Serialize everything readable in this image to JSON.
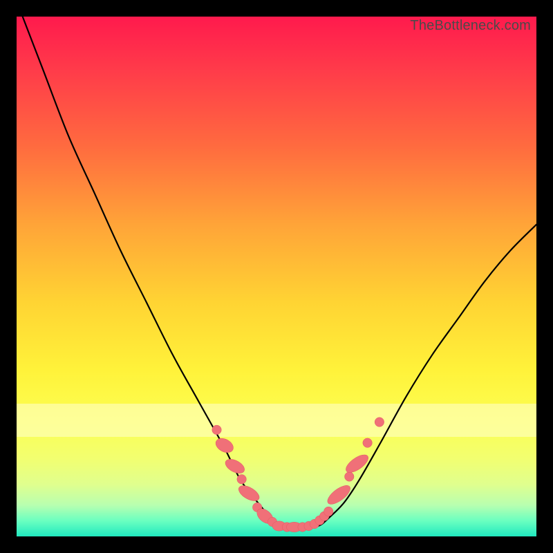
{
  "watermark": "TheBottleneck.com",
  "colors": {
    "background": "#000000",
    "curve": "#000000",
    "markers_fill": "#f07078",
    "markers_stroke": "#e05a62"
  },
  "chart_data": {
    "type": "line",
    "title": "",
    "xlabel": "",
    "ylabel": "",
    "xlim": [
      0,
      100
    ],
    "ylim": [
      0,
      100
    ],
    "grid": false,
    "legend": false,
    "series": [
      {
        "name": "bottleneck-curve",
        "x": [
          0,
          5,
          10,
          15,
          20,
          25,
          30,
          35,
          40,
          43,
          46,
          49,
          51,
          53,
          55,
          58,
          60,
          63,
          66,
          70,
          75,
          80,
          85,
          90,
          95,
          100
        ],
        "y": [
          103,
          90,
          77,
          66,
          55,
          45,
          35,
          26,
          17,
          11,
          7,
          3.5,
          2.0,
          1.8,
          1.8,
          2.0,
          3.5,
          6.5,
          11,
          18,
          27,
          35,
          42,
          49,
          55,
          60
        ]
      }
    ],
    "markers": [
      {
        "cx": 38.5,
        "cy": 20.5,
        "r": 0.9
      },
      {
        "cx": 40.0,
        "cy": 17.5,
        "rx": 1.2,
        "ry": 1.8,
        "rot": -62
      },
      {
        "cx": 42.0,
        "cy": 13.5,
        "rx": 1.1,
        "ry": 2.0,
        "rot": -62
      },
      {
        "cx": 43.3,
        "cy": 11.0,
        "r": 0.9
      },
      {
        "cx": 44.7,
        "cy": 8.3,
        "rx": 1.1,
        "ry": 2.2,
        "rot": -60
      },
      {
        "cx": 46.3,
        "cy": 5.6,
        "r": 0.9
      },
      {
        "cx": 47.8,
        "cy": 3.9,
        "rx": 1.1,
        "ry": 1.8,
        "rot": -50
      },
      {
        "cx": 49.2,
        "cy": 2.8,
        "r": 0.9
      },
      {
        "cx": 50.5,
        "cy": 2.0,
        "rx": 1.3,
        "ry": 0.95,
        "rot": 0
      },
      {
        "cx": 52.0,
        "cy": 1.8,
        "r": 0.9
      },
      {
        "cx": 53.4,
        "cy": 1.8,
        "rx": 1.5,
        "ry": 0.95,
        "rot": 0
      },
      {
        "cx": 55.0,
        "cy": 1.8,
        "r": 0.9
      },
      {
        "cx": 56.2,
        "cy": 2.0,
        "r": 0.9
      },
      {
        "cx": 57.3,
        "cy": 2.4,
        "r": 0.9
      },
      {
        "cx": 58.3,
        "cy": 3.1,
        "r": 0.9
      },
      {
        "cx": 59.2,
        "cy": 3.9,
        "r": 0.9
      },
      {
        "cx": 60.0,
        "cy": 4.8,
        "r": 0.9
      },
      {
        "cx": 62.0,
        "cy": 8.0,
        "rx": 1.1,
        "ry": 2.6,
        "rot": 53
      },
      {
        "cx": 64.0,
        "cy": 11.5,
        "r": 0.9
      },
      {
        "cx": 65.5,
        "cy": 14.0,
        "rx": 1.1,
        "ry": 2.5,
        "rot": 55
      },
      {
        "cx": 67.5,
        "cy": 18.0,
        "r": 0.9
      },
      {
        "cx": 69.8,
        "cy": 22.0,
        "r": 0.9
      }
    ]
  }
}
